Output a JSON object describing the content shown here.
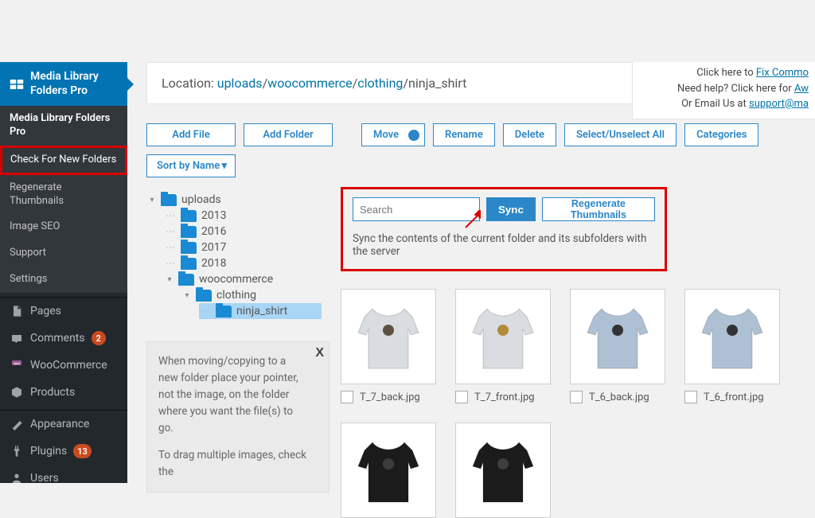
{
  "sidebar": {
    "top_label": "Media Library Folders Pro",
    "sub": [
      "Media Library Folders Pro",
      "Check For New Folders",
      "Regenerate Thumbnails",
      "Image SEO",
      "Support",
      "Settings"
    ],
    "items": [
      {
        "label": "Pages"
      },
      {
        "label": "Comments",
        "badge": "2"
      },
      {
        "label": "WooCommerce"
      },
      {
        "label": "Products"
      },
      {
        "label": "Appearance"
      },
      {
        "label": "Plugins",
        "badge": "13"
      },
      {
        "label": "Users"
      }
    ]
  },
  "help": {
    "line1_prefix": "Click here to ",
    "line1_link": "Fix Commo",
    "line2_prefix": "Need help? Click here for ",
    "line2_link": "Aw",
    "line3_prefix": "Or Email Us at ",
    "line3_link": "support@ma"
  },
  "location": {
    "label": "Location: ",
    "parts": [
      "uploads",
      "woocommerce",
      "clothing"
    ],
    "current": "ninja_shirt"
  },
  "toolbar": {
    "add_file": "Add File",
    "add_folder": "Add Folder",
    "move": "Move",
    "rename": "Rename",
    "delete": "Delete",
    "select_all": "Select/Unselect All",
    "categories": "Categories",
    "sort": "Sort by Name"
  },
  "tools": {
    "search_placeholder": "Search",
    "sync": "Sync",
    "regen": "Regenerate Thumbnails",
    "sync_desc": "Sync the contents of the current folder and its subfolders with the server"
  },
  "tree": {
    "root": "uploads",
    "y1": "2013",
    "y2": "2016",
    "y3": "2017",
    "y4": "2018",
    "wc": "woocommerce",
    "clothing": "clothing",
    "ninja": "ninja_shirt"
  },
  "info": {
    "p1": "When moving/copying to a new folder place your pointer, not the image, on the folder where you want the file(s) to go.",
    "p2": "To drag multiple images, check the"
  },
  "files": {
    "row1": [
      {
        "name": "T_7_back.jpg",
        "color": "#d9dde1",
        "hex": "#5b513f"
      },
      {
        "name": "T_7_front.jpg",
        "color": "#d9dde1",
        "hex": "#b3893c"
      },
      {
        "name": "T_6_back.jpg",
        "color": "#aec1d4",
        "hex": "#333333"
      },
      {
        "name": "T_6_front.jpg",
        "color": "#aec1d4",
        "hex": "#333333"
      }
    ],
    "row2": [
      {
        "name": "",
        "color": "#1b1b1b",
        "hex": "#3d3d3d"
      },
      {
        "name": "",
        "color": "#1b1b1b",
        "hex": "#3d3d3d"
      }
    ]
  }
}
